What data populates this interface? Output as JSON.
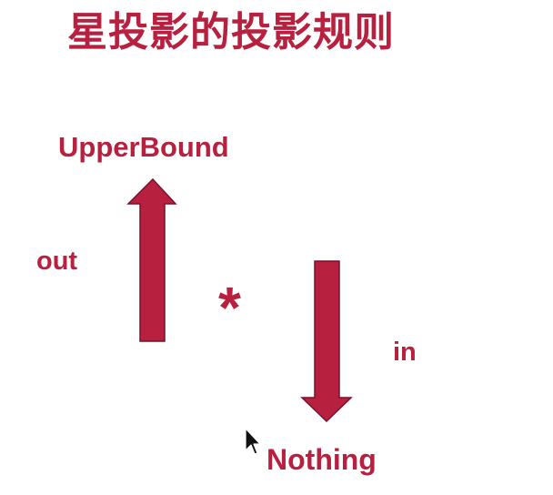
{
  "title": "星投影的投影规则",
  "labels": {
    "upper_bound": "UpperBound",
    "out": "out",
    "star": "*",
    "in": "in",
    "nothing": "Nothing"
  },
  "colors": {
    "accent": "#B8203F",
    "arrow_outline": "#7A1128",
    "background": "#FFFFFF"
  },
  "icons": {
    "cursor": "mouse-pointer-icon"
  }
}
